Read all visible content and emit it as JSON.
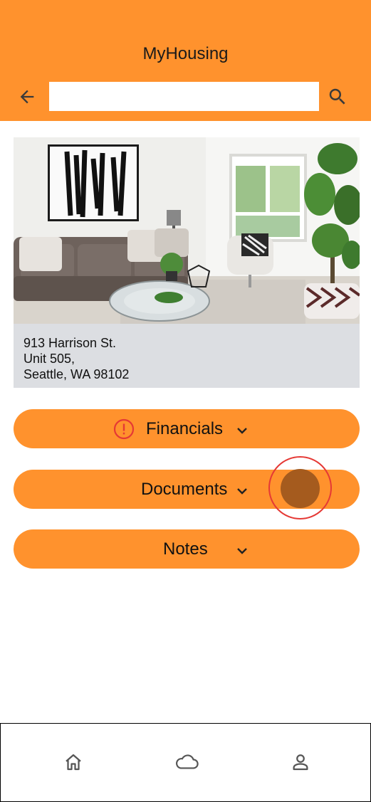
{
  "app": {
    "title": "MyHousing"
  },
  "search": {
    "value": "",
    "placeholder": ""
  },
  "property": {
    "address_line1": "913 Harrison St.",
    "address_line2": "Unit 505,",
    "address_line3": "Seattle, WA 98102"
  },
  "sections": [
    {
      "label": "Financials",
      "has_alert": true
    },
    {
      "label": "Documents",
      "has_alert": false
    },
    {
      "label": "Notes",
      "has_alert": false
    }
  ],
  "bottom_nav": {
    "items": [
      {
        "icon": "home-icon"
      },
      {
        "icon": "cloud-icon"
      },
      {
        "icon": "person-icon"
      }
    ]
  },
  "colors": {
    "accent": "#FF922D",
    "card_bg": "#DCDEE2",
    "alert": "#E53935",
    "touch_indicator": "#A55B1E"
  }
}
